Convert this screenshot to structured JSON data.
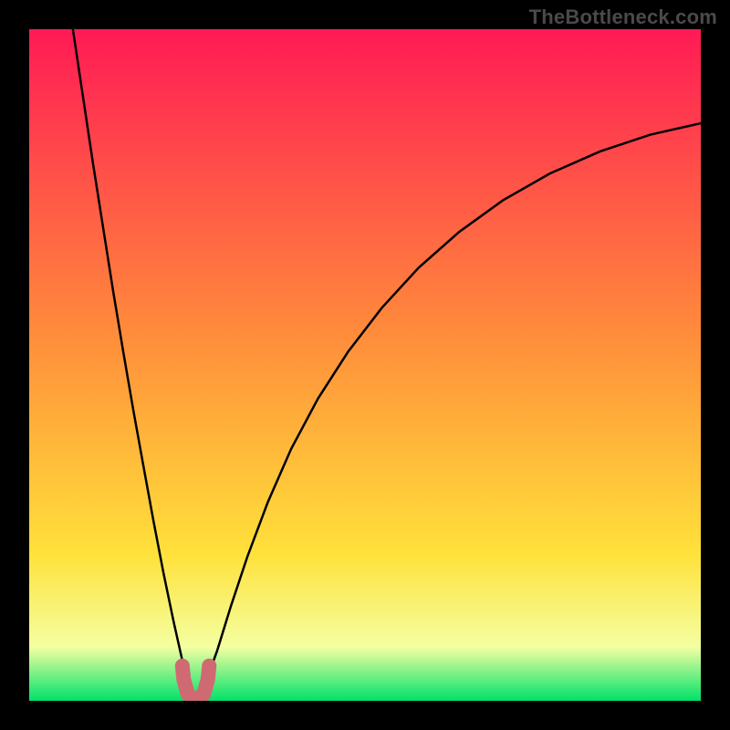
{
  "watermark": "TheBottleneck.com",
  "chart_data": {
    "type": "line",
    "title": "",
    "xlabel": "",
    "ylabel": "",
    "xlim": [
      0,
      1
    ],
    "ylim": [
      0,
      1
    ],
    "grid": false,
    "background_gradient": {
      "top_color": "#ff1a55",
      "mid1_color": "#ff8b3b",
      "mid2_color": "#ffe13a",
      "bottom_color": "#00e26a"
    },
    "dip_x": 0.245,
    "annotations": [
      {
        "text": "TheBottleneck.com",
        "position": "top-right",
        "color": "#4a4a4a"
      }
    ],
    "series": [
      {
        "name": "left-arm",
        "color": "#000000",
        "width": 2.5,
        "x": [
          0.065,
          0.08,
          0.095,
          0.11,
          0.125,
          0.14,
          0.155,
          0.17,
          0.185,
          0.2,
          0.215,
          0.228,
          0.238
        ],
        "y": [
          1.0,
          0.9,
          0.8,
          0.705,
          0.61,
          0.52,
          0.433,
          0.35,
          0.268,
          0.19,
          0.118,
          0.06,
          0.025
        ]
      },
      {
        "name": "right-arm",
        "color": "#000000",
        "width": 2.5,
        "x": [
          0.262,
          0.28,
          0.3,
          0.325,
          0.355,
          0.39,
          0.43,
          0.475,
          0.525,
          0.58,
          0.64,
          0.705,
          0.775,
          0.85,
          0.925,
          1.0
        ],
        "y": [
          0.025,
          0.075,
          0.14,
          0.215,
          0.295,
          0.375,
          0.45,
          0.52,
          0.585,
          0.645,
          0.698,
          0.745,
          0.785,
          0.818,
          0.843,
          0.86
        ]
      },
      {
        "name": "dip-marker",
        "color": "#cf6a73",
        "width": 16,
        "linecap": "round",
        "x": [
          0.228,
          0.23,
          0.236,
          0.244,
          0.252,
          0.26,
          0.266,
          0.268
        ],
        "y": [
          0.052,
          0.032,
          0.01,
          0.004,
          0.004,
          0.01,
          0.032,
          0.052
        ]
      }
    ]
  }
}
